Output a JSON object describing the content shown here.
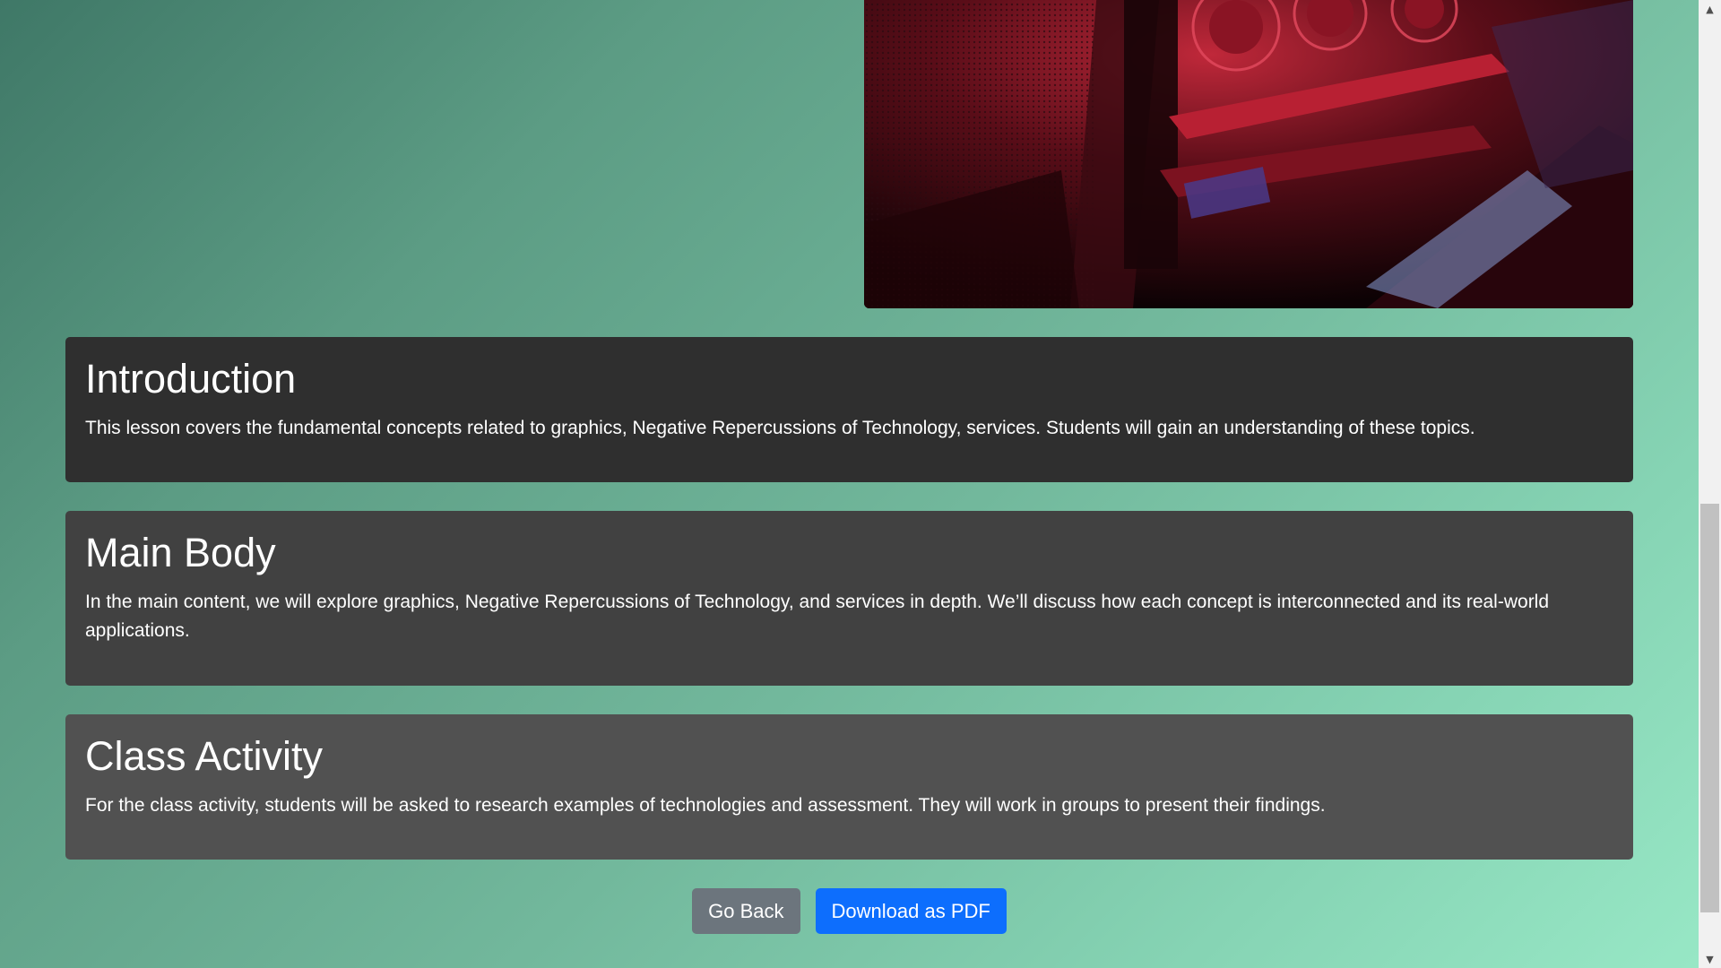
{
  "hero": {
    "image_description_icon": "graphics-card-photo"
  },
  "sections": {
    "introduction": {
      "title": "Introduction",
      "text": "This lesson covers the fundamental concepts related to graphics, Negative Repercussions of Technology, services. Students will gain an understanding of these topics."
    },
    "main_body": {
      "title": "Main Body",
      "text": "In the main content, we will explore graphics, Negative Repercussions of Technology, and services in depth. We’ll discuss how each concept is interconnected and its real-world applications."
    },
    "class_activity": {
      "title": "Class Activity",
      "text": "For the class activity, students will be asked to research examples of technologies and assessment. They will work in groups to present their findings."
    }
  },
  "actions": {
    "go_back_label": "Go Back",
    "download_label": "Download as PDF"
  },
  "colors": {
    "primary_button": "#0d6efd",
    "secondary_button": "#6c757d",
    "card_intro": "#2f2f2f",
    "card_main": "#414141",
    "card_activity": "#515151"
  },
  "scrollbar": {
    "up_icon": "scroll-up-arrow-icon",
    "down_icon": "scroll-down-arrow-icon"
  }
}
